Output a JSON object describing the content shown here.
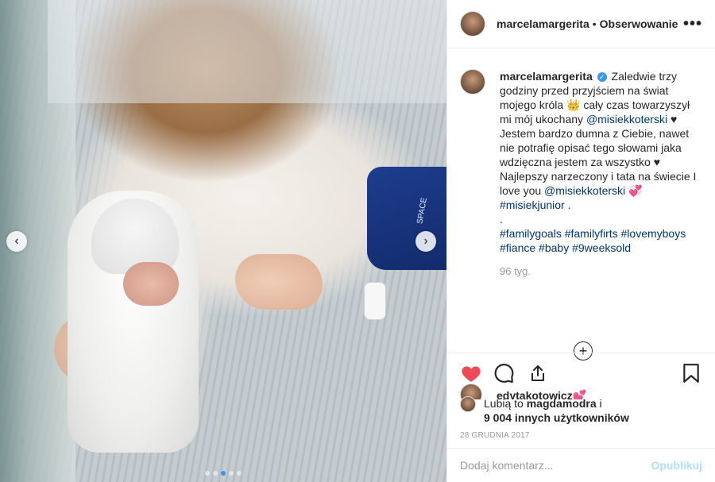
{
  "header": {
    "username": "marcelamargerita",
    "dot": "•",
    "follow_label": "Obserwowanie",
    "more_icon": "more-horizontal-icon"
  },
  "caption": {
    "username": "marcelamargerita",
    "verified_icon": "verified-badge-icon",
    "text_1": "Zaledwie trzy godziny przed przyjściem na świat mojego króla 👑 cały czas towarzyszył mi mój ukochany",
    "mention_1": "@misiekkoterski",
    "text_2": "♥ Jestem bardzo dumna z Ciebie, nawet nie potrafię opisać tego słowami jaka wdzięczna jestem za wszystko ♥ Najlepszy narzeczony i tata na świecie I love you",
    "mention_2": "@misiekkoterski",
    "text_3": "💞",
    "tag_1": "#misiekjunior",
    "text_4": ".",
    "text_5": ".",
    "hashtags": [
      "#familygoals",
      "#familyfirts",
      "#lovemyboys",
      "#fiance",
      "#baby",
      "#9weeksold"
    ],
    "time": "96 tyg."
  },
  "load_more_icon": "plus-circle-icon",
  "comment_peek": {
    "username": "edytakotowicz",
    "emoji": "💕"
  },
  "actions": {
    "like_icon": "heart-filled-icon",
    "comment_icon": "comment-icon",
    "share_icon": "share-icon",
    "save_icon": "bookmark-icon",
    "like_color": "#ed4956"
  },
  "likes": {
    "prefix": "Lubią to",
    "user": "magdamodra",
    "conj": "i",
    "count_text": "9 004 innych użytkowników"
  },
  "post_date": "28 GRUDNIA 2017",
  "comment_box": {
    "placeholder": "Dodaj komentarz...",
    "post_label": "Opublikuj"
  },
  "carousel": {
    "prev_icon": "chevron-left-icon",
    "next_icon": "chevron-right-icon",
    "prev_glyph": "‹",
    "next_glyph": "›",
    "slides": 5,
    "active_index": 2
  },
  "photo": {
    "cuff_label": "SPACE"
  },
  "colors": {
    "link": "#003569",
    "accent_blue": "#3897f0",
    "muted": "#999999",
    "post_disabled": "#b2dffc"
  }
}
